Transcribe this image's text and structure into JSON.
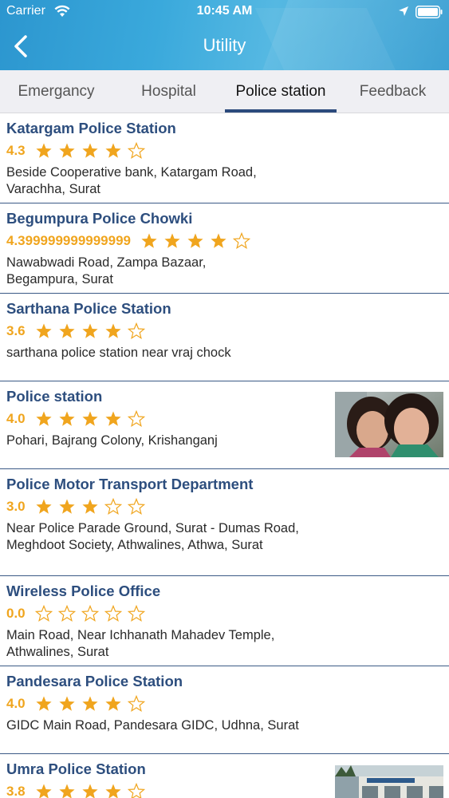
{
  "status_bar": {
    "carrier": "Carrier",
    "time": "10:45 AM",
    "icons": [
      "wifi-icon",
      "location-icon",
      "battery-icon"
    ]
  },
  "nav": {
    "title": "Utility",
    "back_icon": "chevron-left-icon"
  },
  "tabs": [
    {
      "label": "Emergancy",
      "active": false
    },
    {
      "label": "Hospital",
      "active": false
    },
    {
      "label": "Police station",
      "active": true
    },
    {
      "label": "Feedback",
      "active": false
    }
  ],
  "colors": {
    "header": "#3aa9dc",
    "title_text": "#2d4e7e",
    "rating": "#f0a51e",
    "divider": "#3b5a86",
    "tab_indicator": "#2b4a7c"
  },
  "stations": [
    {
      "name": "Katargam Police Station",
      "rating_text": "4.3",
      "stars": 4,
      "address": "Beside Cooperative bank, Katargam Road, Varachha, Surat",
      "has_image": false
    },
    {
      "name": "Begumpura Police Chowki",
      "rating_text": "4.399999999999999",
      "stars": 4,
      "address": "Nawabwadi Road, Zampa Bazaar, Begampura, Surat",
      "has_image": false
    },
    {
      "name": "Sarthana Police Station",
      "rating_text": "3.6",
      "stars": 4,
      "address": "sarthana police station near vraj chock",
      "has_image": false
    },
    {
      "name": "Police station",
      "rating_text": "4.0",
      "stars": 4,
      "address": "Pohari, Bajrang Colony, Krishanganj",
      "has_image": true
    },
    {
      "name": "Police Motor Transport Department",
      "rating_text": "3.0",
      "stars": 3,
      "address": "Near Police Parade Ground, Surat - Dumas Road, Meghdoot Society, Athwalines, Athwa, Surat",
      "has_image": false
    },
    {
      "name": "Wireless Police Office",
      "rating_text": "0.0",
      "stars": 0,
      "address": "Main Road, Near Ichhanath Mahadev Temple, Athwalines, Surat",
      "has_image": false
    },
    {
      "name": "Pandesara Police Station",
      "rating_text": "4.0",
      "stars": 4,
      "address": "GIDC Main Road, Pandesara GIDC, Udhna, Surat",
      "has_image": false
    },
    {
      "name": "Umra Police Station",
      "rating_text": "3.8",
      "stars": 4,
      "address": "",
      "has_image": true
    }
  ]
}
